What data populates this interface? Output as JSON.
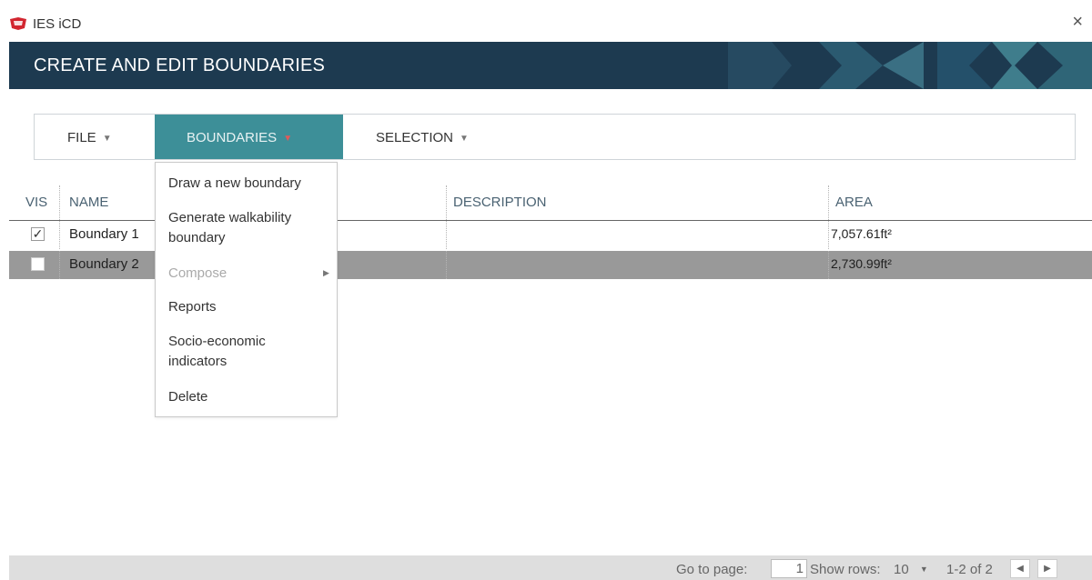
{
  "app": {
    "name": "IES iCD",
    "close_label": "×"
  },
  "banner": {
    "title": "CREATE AND EDIT BOUNDARIES"
  },
  "toolbar": {
    "file_label": "FILE",
    "boundaries_label": "BOUNDARIES",
    "selection_label": "SELECTION",
    "active_tab": "BOUNDARIES",
    "caret_icon": "caret-down-icon"
  },
  "table": {
    "columns": [
      "VIS",
      "NAME",
      "DESCRIPTION",
      "AREA"
    ],
    "rows": [
      {
        "vis": "✓",
        "checked": true,
        "name": "Boundary 1",
        "description": "",
        "area": "7,057.61ft²",
        "selected": false
      },
      {
        "vis": "",
        "checked": false,
        "name": "Boundary 2",
        "description": "",
        "area": "2,730.99ft²",
        "selected": true
      }
    ]
  },
  "menu": {
    "items": [
      {
        "label": "Draw a new boundary",
        "enabled": true
      },
      {
        "label": "Generate walkability boundary",
        "enabled": true
      },
      {
        "label": "Compose",
        "enabled": false,
        "submenu": true
      },
      {
        "label": "Reports",
        "enabled": true
      },
      {
        "label": "Socio-economic indicators",
        "enabled": true
      },
      {
        "label": "Delete",
        "enabled": true
      }
    ],
    "line_breaks": {
      "generate_1": "Generate walkability",
      "generate_2": "boundary",
      "socio_1": "Socio-economic",
      "socio_2": "indicators"
    },
    "submenu_arrow": "▶"
  },
  "footer": {
    "go_to_page_label": "Go to page:",
    "page_value": "1",
    "show_rows_label": "Show rows:",
    "rows_value": "10",
    "rows_caret": "▼",
    "range": "1-2 of 2",
    "prev": "◀",
    "next": "▶"
  },
  "colors": {
    "banner_bg": "#1d3a50",
    "active_tab_bg": "#3d8f98",
    "selected_row_bg": "#999999",
    "footer_bg": "#dedede"
  }
}
